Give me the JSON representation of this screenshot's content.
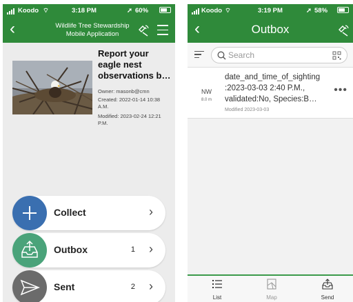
{
  "left_screen": {
    "status": {
      "carrier": "Koodo",
      "time": "3:18 PM",
      "battery": "60%"
    },
    "header": {
      "title": "Wildlife Tree Stewardship\nMobile Application"
    },
    "survey": {
      "title": "Report your eagle nest observations b…",
      "owner": "Owner: masonb@cmn",
      "created": "Created: 2022-01-14 10:38 A.M.",
      "modified": "Modified: 2023-02-24 12:21 P.M."
    },
    "actions": [
      {
        "label": "Collect",
        "count": "",
        "color": "#3a6fb0"
      },
      {
        "label": "Outbox",
        "count": "1",
        "color": "#4aa37a"
      },
      {
        "label": "Sent",
        "count": "2",
        "color": "#6b6b6b"
      }
    ]
  },
  "right_screen": {
    "status": {
      "carrier": "Koodo",
      "time": "3:19 PM",
      "battery": "58%"
    },
    "header": {
      "title": "Outbox"
    },
    "search": {
      "placeholder": "Search"
    },
    "item": {
      "direction": "NW",
      "distance": "8.0 m",
      "text": "date_and_time_of_sighting\n:2023-03-03 2:40 P.M.,\nvalidated:No, Species:B…",
      "modified": "Modified 2023-03-03"
    },
    "tabs": [
      {
        "label": "List",
        "active": true
      },
      {
        "label": "Map",
        "active": false
      },
      {
        "label": "Send",
        "active": true
      }
    ]
  },
  "colors": {
    "header_green": "#2f8a3a",
    "tab_accent": "#3a9a4a"
  },
  "icons": [
    "back-chevron-icon",
    "satellite-location-icon",
    "hamburger-menu-icon",
    "filter-icon",
    "search-icon",
    "qr-code-icon",
    "more-icon",
    "list-icon",
    "map-icon",
    "send-icon",
    "plus-icon",
    "outbox-tray-icon",
    "paper-plane-icon",
    "chevron-right-icon"
  ]
}
